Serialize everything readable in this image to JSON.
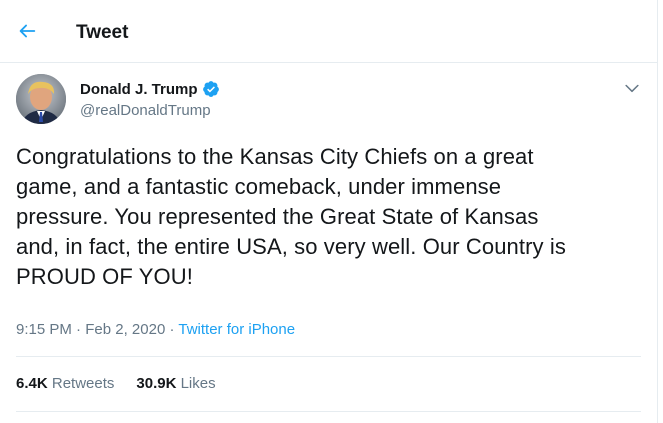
{
  "header": {
    "title": "Tweet",
    "back_icon": "arrow-left-icon",
    "accent": "#1da1f2"
  },
  "tweet": {
    "display_name": "Donald J. Trump",
    "handle": "@realDonaldTrump",
    "verified_icon": "verified-badge-icon",
    "text": "Congratulations to the Kansas City Chiefs on a great\ngame, and a fantastic comeback, under immense\npressure. You represented the Great State of Kansas\nand, in fact, the entire USA, so very well. Our Country is\nPROUD OF YOU!",
    "time": "9:15 PM",
    "date": "Feb 2, 2020",
    "separator": "·",
    "source": "Twitter for iPhone",
    "retweets_count": "6.4K",
    "retweets_label": "Retweets",
    "likes_count": "30.9K",
    "likes_label": "Likes"
  }
}
